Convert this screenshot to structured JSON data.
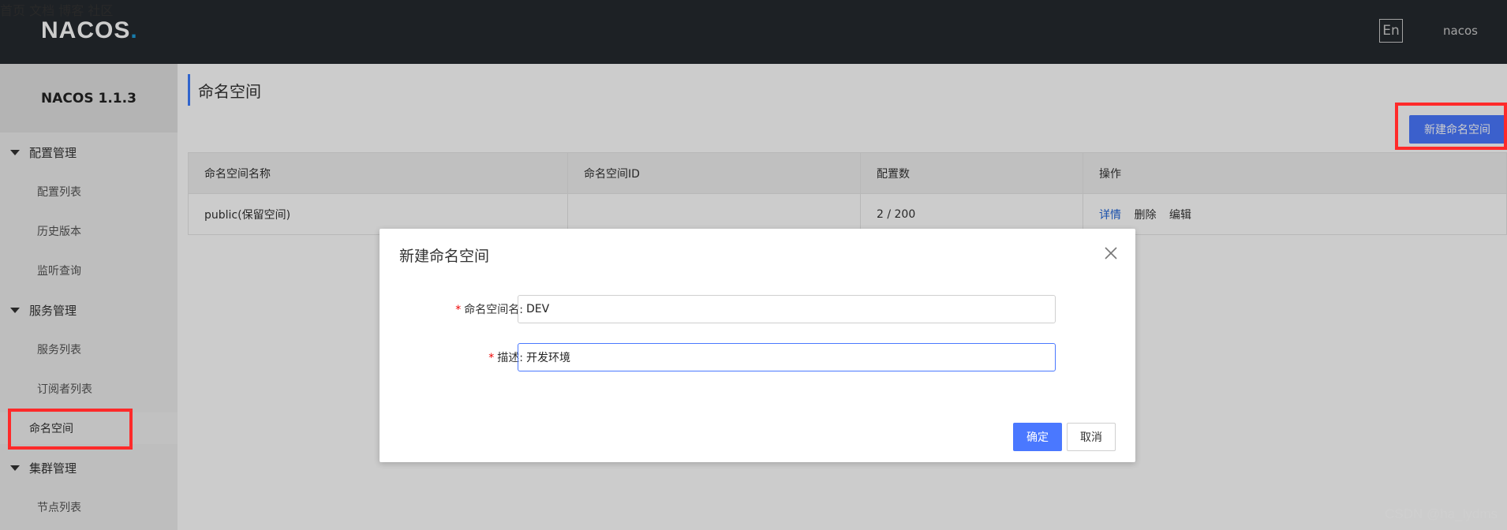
{
  "topbar": {
    "logo": "NACOS.",
    "nav": [
      "首页",
      "文档",
      "博客",
      "社区"
    ],
    "lang": "En",
    "user": "nacos"
  },
  "sidebar": {
    "version": "NACOS 1.1.3",
    "groups": [
      {
        "label": "配置管理",
        "items": [
          "配置列表",
          "历史版本",
          "监听查询"
        ]
      },
      {
        "label": "服务管理",
        "items": [
          "服务列表",
          "订阅者列表"
        ]
      },
      {
        "label": "命名空间",
        "items": []
      },
      {
        "label": "集群管理",
        "items": [
          "节点列表"
        ]
      }
    ],
    "active": "命名空间"
  },
  "main": {
    "title": "命名空间",
    "new_button": "新建命名空间",
    "table": {
      "headers": [
        "命名空间名称",
        "命名空间ID",
        "配置数",
        "操作"
      ],
      "rows": [
        {
          "name": "public(保留空间)",
          "id": "",
          "count": "2 / 200",
          "ops": [
            "详情",
            "删除",
            "编辑"
          ]
        }
      ]
    }
  },
  "dialog": {
    "title": "新建命名空间",
    "fields": [
      {
        "label": "命名空间名:",
        "value": "DEV"
      },
      {
        "label": "描述:",
        "value": "开发环境"
      }
    ],
    "ok": "确定",
    "cancel": "取消"
  },
  "watermark": "CSDN @ha_lydms",
  "colors": {
    "accent": "#4a78ff",
    "highlight": "#ff2a2a",
    "topbar": "#252a2f"
  }
}
